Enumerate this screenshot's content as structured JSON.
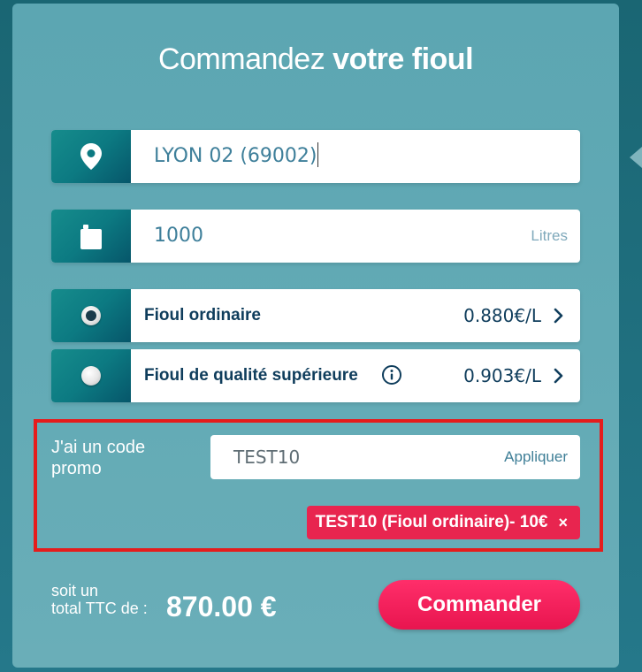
{
  "header": {
    "title_light": "Commandez",
    "title_bold": "votre fioul"
  },
  "location": {
    "icon": "map-pin-icon",
    "value": "LYON 02 (69002)"
  },
  "quantity": {
    "icon": "fuel-can-icon",
    "value": "1000",
    "unit": "Litres"
  },
  "fuel_options": [
    {
      "label": "Fioul ordinaire",
      "price": "0.880€/L",
      "selected": true
    },
    {
      "label": "Fioul de qualité supérieure",
      "price": "0.903€/L",
      "selected": false,
      "info_icon": "info-icon"
    }
  ],
  "promo": {
    "label": "J'ai un code promo",
    "code": "TEST10",
    "apply_label": "Appliquer",
    "applied_tag": "TEST10 (Fioul ordinaire)- 10€",
    "remove_symbol": "×"
  },
  "total": {
    "label_line1": "soit un",
    "label_line2": "total TTC de :",
    "amount": "870.00 €"
  },
  "order_button": "Commander",
  "colors": {
    "accent_pink": "#e8254f",
    "dark_teal": "#06566a",
    "highlight_red": "#e51c1c",
    "text_navy": "#0f3d5c"
  }
}
